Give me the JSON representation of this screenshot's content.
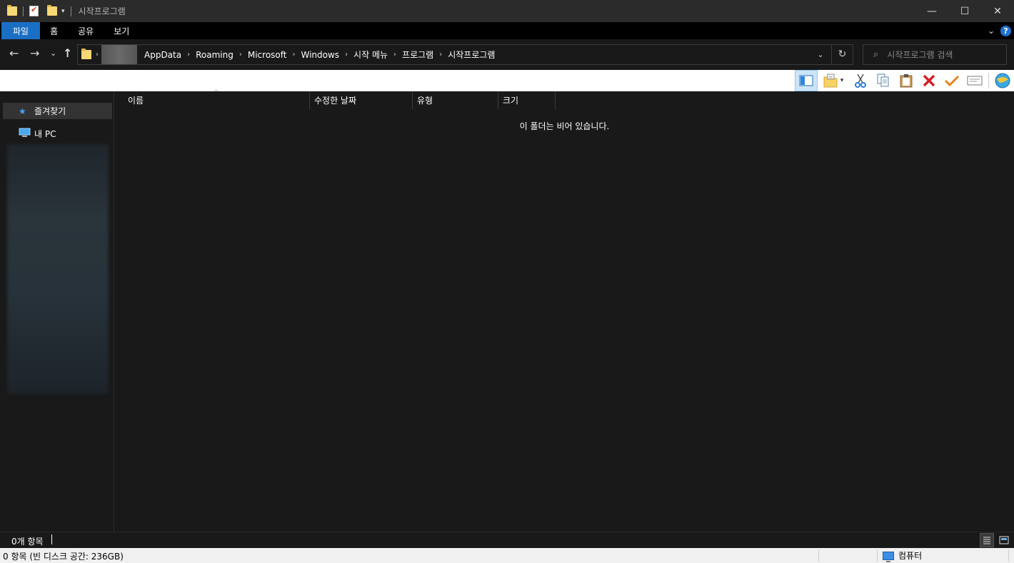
{
  "window": {
    "title": "시작프로그램",
    "controls": {
      "minimize": "—",
      "maximize": "☐",
      "close": "✕"
    }
  },
  "ribbon": {
    "tabs": [
      "파일",
      "홈",
      "공유",
      "보기"
    ],
    "help": "?"
  },
  "address": {
    "breadcrumbs": [
      "AppData",
      "Roaming",
      "Microsoft",
      "Windows",
      "시작 메뉴",
      "프로그램",
      "시작프로그램"
    ],
    "refresh": "↻",
    "dropdown": "⌄"
  },
  "search": {
    "placeholder": "시작프로그램 검색",
    "icon": "⌕"
  },
  "nav": {
    "back": "←",
    "forward": "→",
    "recent": "⌄",
    "up": "↑",
    "items": [
      {
        "label": "즐겨찾기",
        "icon": "★"
      },
      {
        "label": "내 PC",
        "icon": "pc-icon"
      }
    ]
  },
  "toolbar": {
    "icons": [
      "preview-pane-icon",
      "new-folder-icon",
      "cut-icon",
      "copy-icon",
      "paste-icon",
      "delete-icon",
      "select-icon",
      "rename-icon",
      "globe-icon"
    ]
  },
  "columns": {
    "name": "이름",
    "modified": "수정한 날짜",
    "type": "유형",
    "size": "크기"
  },
  "content": {
    "empty_message": "이 폴더는 비어 있습니다."
  },
  "status": {
    "item_count": "0개 항목"
  },
  "bottom_bar": {
    "left": "0 항목 (빈 디스크 공간: 236GB)",
    "right": "컴퓨터"
  }
}
